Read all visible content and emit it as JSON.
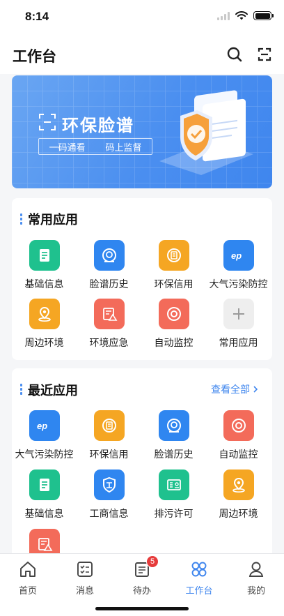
{
  "status_bar": {
    "time": "8:14"
  },
  "header": {
    "title": "工作台",
    "search_icon": "search-icon",
    "scan_icon": "scan-icon"
  },
  "banner": {
    "title": "环保脸谱",
    "subtitle_1": "一码通看",
    "subtitle_2": "码上监督"
  },
  "common_apps": {
    "title": "常用应用",
    "items": [
      {
        "label": "基础信息",
        "icon": "document-icon",
        "color": "#1fc18e"
      },
      {
        "label": "脸谱历史",
        "icon": "face-history-icon",
        "color": "#2f86f0"
      },
      {
        "label": "环保信用",
        "icon": "credit-icon",
        "color": "#f5a623"
      },
      {
        "label": "大气污染防控",
        "icon": "ep-icon",
        "color": "#2f86f0"
      },
      {
        "label": "周边环境",
        "icon": "location-icon",
        "color": "#f5a623"
      },
      {
        "label": "环境应急",
        "icon": "emergency-icon",
        "color": "#f36b5a"
      },
      {
        "label": "自动监控",
        "icon": "monitor-icon",
        "color": "#f36b5a"
      },
      {
        "label": "常用应用",
        "icon": "plus-icon",
        "color": "#eeeeee"
      }
    ]
  },
  "recent_apps": {
    "title": "最近应用",
    "view_all": "查看全部",
    "items": [
      {
        "label": "大气污染防控",
        "icon": "ep-icon",
        "color": "#2f86f0"
      },
      {
        "label": "环保信用",
        "icon": "credit-icon",
        "color": "#f5a623"
      },
      {
        "label": "脸谱历史",
        "icon": "face-history-icon",
        "color": "#2f86f0"
      },
      {
        "label": "自动监控",
        "icon": "monitor-icon",
        "color": "#f36b5a"
      },
      {
        "label": "基础信息",
        "icon": "document-icon",
        "color": "#1fc18e"
      },
      {
        "label": "工商信息",
        "icon": "business-icon",
        "color": "#2f86f0"
      },
      {
        "label": "排污许可",
        "icon": "permit-icon",
        "color": "#1fc18e"
      },
      {
        "label": "周边环境",
        "icon": "location-icon",
        "color": "#f5a623"
      },
      {
        "label": "",
        "icon": "emergency-icon",
        "color": "#f36b5a"
      }
    ]
  },
  "tabbar": {
    "items": [
      {
        "label": "首页",
        "icon": "home-icon"
      },
      {
        "label": "消息",
        "icon": "message-icon"
      },
      {
        "label": "待办",
        "icon": "todo-icon",
        "badge": "5"
      },
      {
        "label": "工作台",
        "icon": "workbench-icon",
        "active": true
      },
      {
        "label": "我的",
        "icon": "profile-icon"
      }
    ]
  },
  "colors": {
    "accent": "#3f86ee",
    "badge": "#e63b3b"
  }
}
